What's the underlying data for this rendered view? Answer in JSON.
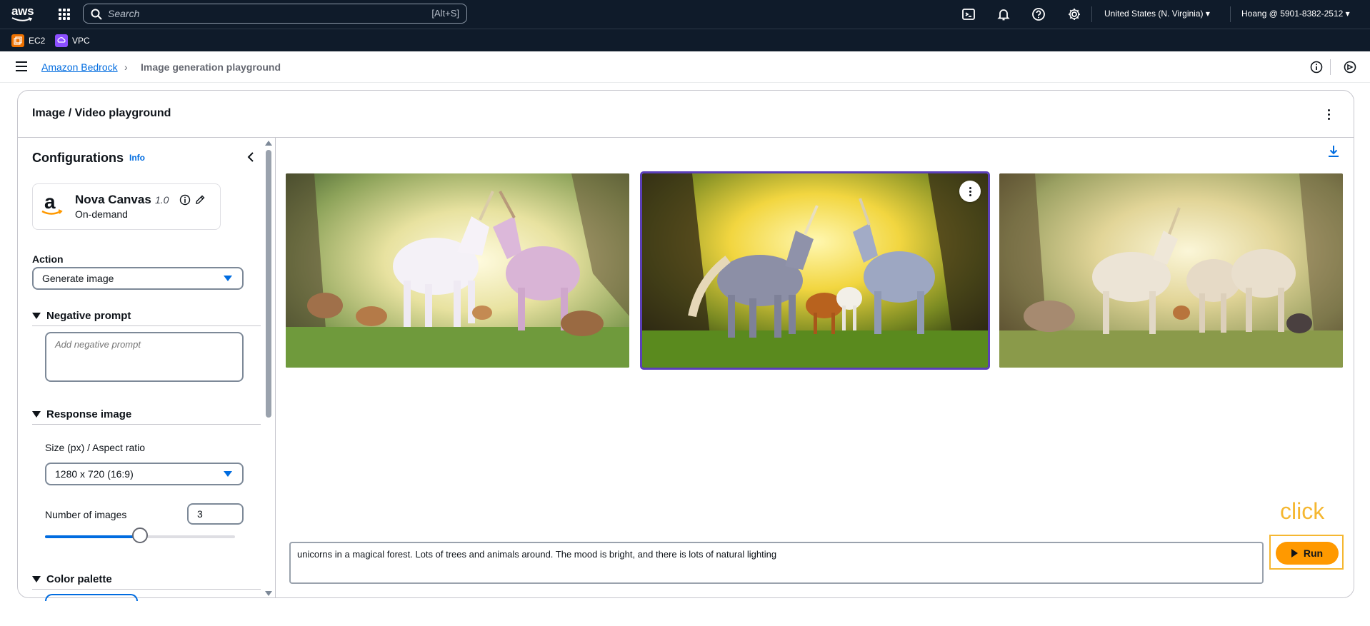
{
  "topnav": {
    "logo_text": "aws",
    "search_placeholder": "Search",
    "search_shortcut": "[Alt+S]",
    "region": "United States (N. Virginia) ▾",
    "account": "Hoang @ 5901-8382-2512 ▾",
    "icons": [
      "services-grid-icon",
      "cloudshell-icon",
      "notifications-bell-icon",
      "help-icon",
      "settings-gear-icon"
    ]
  },
  "favorites": [
    {
      "label": "EC2",
      "color": "#ed7100"
    },
    {
      "label": "VPC",
      "color": "#8c4fff"
    }
  ],
  "breadcrumb": {
    "link": "Amazon Bedrock",
    "separator": "›",
    "current": "Image generation playground"
  },
  "card": {
    "title": "Image / Video playground"
  },
  "config": {
    "title": "Configurations",
    "info": "Info",
    "model": {
      "name": "Nova Canvas",
      "version": "1.0",
      "mode": "On-demand"
    },
    "action_label": "Action",
    "action_value": "Generate image",
    "negative_prompt": {
      "heading": "Negative prompt",
      "placeholder": "Add negative prompt"
    },
    "response_image": {
      "heading": "Response image",
      "size_label": "Size (px) / Aspect ratio",
      "size_value": "1280 x 720 (16:9)",
      "num_images_label": "Number of images",
      "num_images_value": "3",
      "slider_fraction": 0.5
    },
    "color_palette": {
      "heading": "Color palette"
    }
  },
  "results": {
    "images": [
      {
        "name": "generated-image-1",
        "selected": false
      },
      {
        "name": "generated-image-2",
        "selected": true
      },
      {
        "name": "generated-image-3",
        "selected": false
      }
    ]
  },
  "prompt": {
    "value": "unicorns in a magical forest. Lots of trees and animals around. The mood is bright, and there is lots of natural lighting"
  },
  "annotation": {
    "label": "click"
  },
  "run_button": {
    "label": "Run"
  },
  "colors": {
    "nav_bg": "#0f1b2a",
    "link": "#006ce0",
    "run": "#ff9900",
    "annotation": "#f5b731",
    "selected_outline": "#5b3fb8"
  }
}
